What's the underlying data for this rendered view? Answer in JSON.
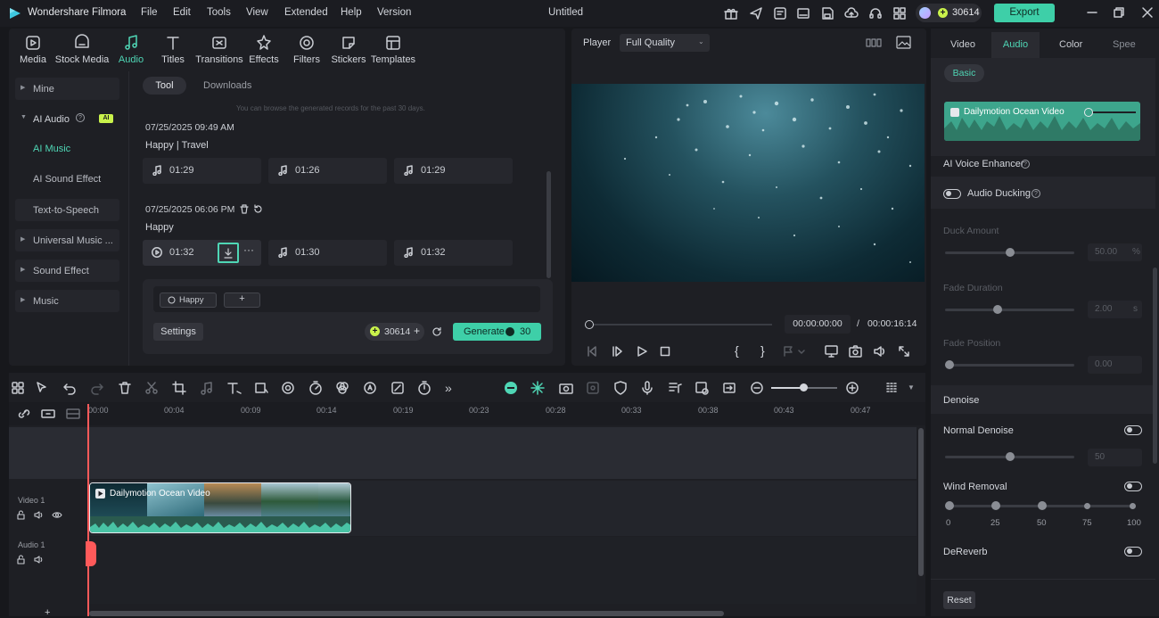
{
  "app": {
    "name": "Wondershare Filmora",
    "doc_title": "Untitled",
    "credits": "30614",
    "export_label": "Export"
  },
  "menu": [
    "File",
    "Edit",
    "Tools",
    "View",
    "Extended",
    "Help",
    "Version"
  ],
  "media_tabs": [
    "Media",
    "Stock Media",
    "Audio",
    "Titles",
    "Transitions",
    "Effects",
    "Filters",
    "Stickers",
    "Templates"
  ],
  "sidebar": {
    "mine": "Mine",
    "ai_audio": "AI Audio",
    "ai_badge": "AI",
    "ai_music": "AI Music",
    "ai_sound_effect": "AI Sound Effect",
    "tts": "Text-to-Speech",
    "universal_music": "Universal Music ...",
    "sound_effect": "Sound Effect",
    "music": "Music"
  },
  "audio_panel": {
    "tab_tool": "Tool",
    "tab_downloads": "Downloads",
    "notice": "You can browse the generated records for the past 30 days.",
    "group1": {
      "date": "07/25/2025 09:49 AM",
      "tags": "Happy | Travel",
      "tracks": [
        "01:29",
        "01:26",
        "01:29"
      ]
    },
    "group2": {
      "date": "07/25/2025 06:06 PM",
      "tags": "Happy",
      "tracks": [
        "01:32",
        "01:30",
        "01:32"
      ]
    },
    "prompt_chip": "Happy",
    "add_chip": "+",
    "settings_label": "Settings",
    "credit_value": "30614",
    "generate_label": "Generate",
    "generate_cost": "30"
  },
  "player": {
    "label": "Player",
    "quality": "Full Quality",
    "current_time": "00:00:00:00",
    "separator": "/",
    "total_time": "00:00:16:14",
    "progress": 0
  },
  "timeline": {
    "ruler": [
      "00:00",
      "00:04",
      "00:09",
      "00:14",
      "00:19",
      "00:23",
      "00:28",
      "00:33",
      "00:38",
      "00:43",
      "00:47"
    ],
    "video_track": "Video 1",
    "audio_track": "Audio 1",
    "clip_name": "Dailymotion Ocean Video"
  },
  "right_panel": {
    "tabs": [
      "Video",
      "Audio",
      "Color",
      "Spee"
    ],
    "basic_label": "Basic",
    "clip_name": "Dailymotion Ocean Video",
    "voice_enhancer": "AI Voice Enhancer",
    "audio_ducking": "Audio Ducking",
    "duck_amount": "Duck Amount",
    "duck_value": "50.00",
    "duck_unit": "%",
    "fade_duration": "Fade Duration",
    "fade_duration_value": "2.00",
    "fade_duration_unit": "s",
    "fade_position": "Fade Position",
    "fade_position_value": "0.00",
    "denoise": "Denoise",
    "normal_denoise": "Normal Denoise",
    "normal_denoise_value": "50",
    "wind_removal": "Wind Removal",
    "wind_scale": [
      "0",
      "25",
      "50",
      "75",
      "100"
    ],
    "dereverb": "DeReverb",
    "reset_label": "Reset"
  },
  "colors": {
    "accent": "#4fd6b5",
    "generate": "#3ecfa8",
    "playhead": "#ff5a5a",
    "credit_yellow": "#c9f24b"
  }
}
